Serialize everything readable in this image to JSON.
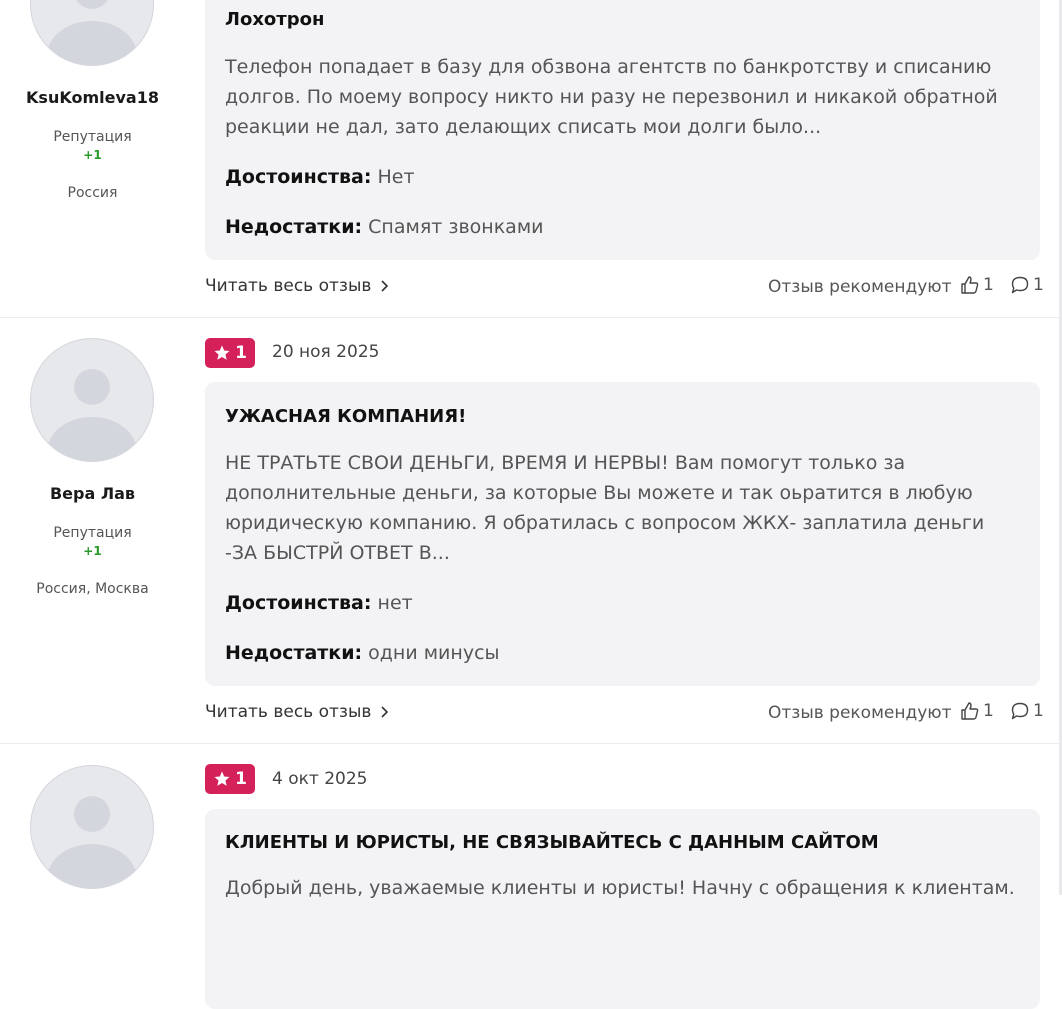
{
  "reviews": [
    {
      "author": {
        "name": "KsuKomleva18",
        "reputation_label": "Репутация",
        "reputation_value": "+1",
        "location": "Россия"
      },
      "title": "Лохотрон",
      "text": "Телефон попадает в базу для обзвона агентств по банкротству и списанию долгов. По моему вопросу никто ни разу не перезвонил и никакой обратной реакции не дал, зато делающих списать мои долги было...",
      "pros_label": "Достоинства:",
      "pros": "Нет",
      "cons_label": "Недостатки:",
      "cons": "Спамят звонками",
      "read_more": "Читать весь отзыв",
      "recommend_label": "Отзыв рекомендуют",
      "likes": "1",
      "comments": "1"
    },
    {
      "rating": "1",
      "date": "20 ноя 2025",
      "author": {
        "name": "Вера Лав",
        "reputation_label": "Репутация",
        "reputation_value": "+1",
        "location": "Россия, Москва"
      },
      "title": "УЖАСНАЯ КОМПАНИЯ!",
      "text": "НЕ ТРАТЬТЕ СВОИ ДЕНЬГИ, ВРЕМЯ И НЕРВЫ! Вам помогут только за дополнительные деньги, за которые Вы можете и так оьратится в любую юридическую компанию. Я обратилась с вопросом ЖКХ- заплатила деньги -ЗА БЫСТРЙ ОТВЕТ В...",
      "pros_label": "Достоинства:",
      "pros": "нет",
      "cons_label": "Недостатки:",
      "cons": "одни минусы",
      "read_more": "Читать весь отзыв",
      "recommend_label": "Отзыв рекомендуют",
      "likes": "1",
      "comments": "1"
    },
    {
      "rating": "1",
      "date": "4 окт 2025",
      "title": "КЛИЕНТЫ И ЮРИСТЫ, НЕ СВЯЗЫВАЙТЕСЬ С ДАННЫМ САЙТОМ",
      "text": "Добрый день, уважаемые клиенты и юристы! Начну с обращения к клиентам."
    }
  ],
  "colors": {
    "badge": "#d5215a",
    "card_bg": "#f3f3f6",
    "reputation": "#2a9a2a"
  },
  "icons": [
    "star-icon",
    "chevron-right-icon",
    "thumbs-up-icon",
    "comment-icon"
  ]
}
